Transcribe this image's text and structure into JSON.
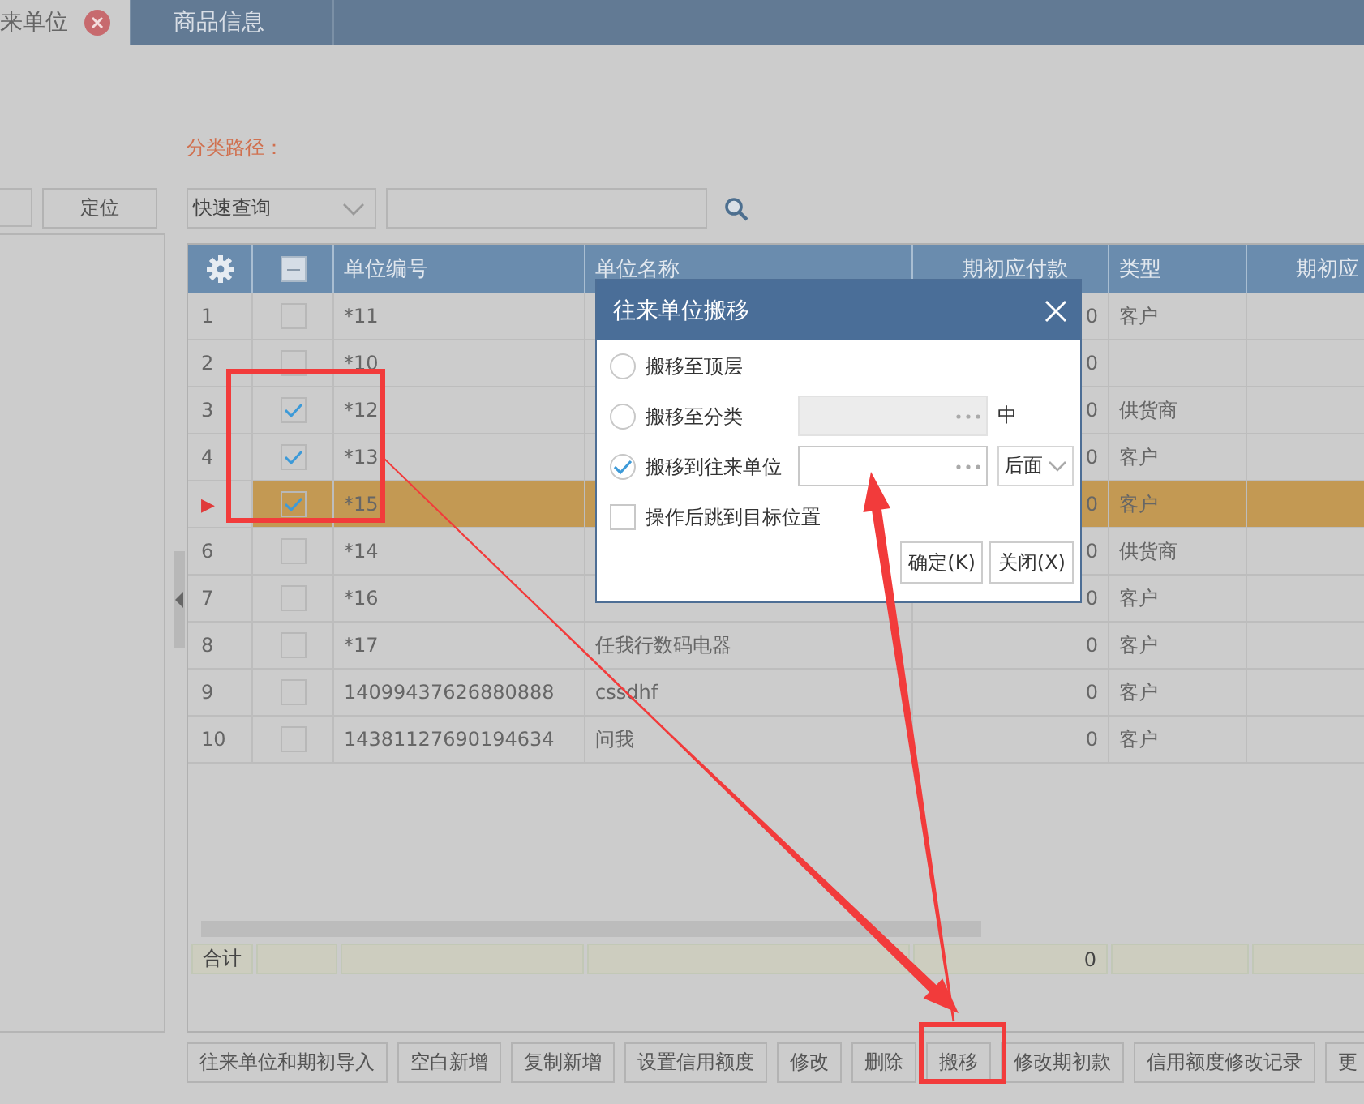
{
  "tabs": [
    {
      "label": "来单位",
      "selected": true,
      "closable": true
    },
    {
      "label": "商品信息",
      "selected": false,
      "closable": false
    }
  ],
  "left_panel": {
    "locate_button": "定位"
  },
  "category_path_label": "分类路径：",
  "toolbar": {
    "query_select": "快速查询"
  },
  "table": {
    "select_all": {
      "indeterminate": true
    },
    "columns": [
      "单位编号",
      "单位名称",
      "期初应付款",
      "类型",
      "期初应"
    ],
    "rows": [
      {
        "index": "1",
        "checked": false,
        "current": false,
        "code": "*11",
        "payable": "0",
        "type": "客户"
      },
      {
        "index": "2",
        "checked": false,
        "current": false,
        "code": "*10",
        "payable": "0"
      },
      {
        "index": "3",
        "checked": true,
        "current": false,
        "code": "*12",
        "payable": "0",
        "type": "供货商"
      },
      {
        "index": "4",
        "checked": true,
        "current": false,
        "code": "*13",
        "payable": "0",
        "type": "客户"
      },
      {
        "checked": true,
        "current": true,
        "marker": "▶",
        "code": "*15",
        "payable": "0",
        "type": "客户"
      },
      {
        "index": "6",
        "checked": false,
        "current": false,
        "code": "*14",
        "payable": "0",
        "type": "供货商"
      },
      {
        "index": "7",
        "checked": false,
        "current": false,
        "code": "*16",
        "payable": "0",
        "type": "客户"
      },
      {
        "index": "8",
        "checked": false,
        "current": false,
        "code": "*17",
        "name": "任我行数码电器",
        "payable": "0",
        "type": "客户"
      },
      {
        "index": "9",
        "checked": false,
        "current": false,
        "code": "14099437626880888",
        "name": "cssdhf",
        "payable": "0",
        "type": "客户"
      },
      {
        "index": "10",
        "checked": false,
        "current": false,
        "code": "14381127690194634",
        "name": "问我",
        "payable": "0",
        "type": "客户"
      }
    ],
    "totals": {
      "label": "合计",
      "payable": "0"
    }
  },
  "buttons": [
    {
      "label": "往来单位和期初导入"
    },
    {
      "label": "空白新增"
    },
    {
      "label": "复制新增"
    },
    {
      "label": "设置信用额度"
    },
    {
      "label": "修改"
    },
    {
      "label": "删除"
    },
    {
      "label": "搬移"
    },
    {
      "label": "修改期初款"
    },
    {
      "label": "信用额度修改记录"
    },
    {
      "label": "更"
    }
  ],
  "dialog": {
    "title": "往来单位搬移",
    "options": [
      {
        "kind": "radio",
        "label": "搬移至顶层",
        "selected": false
      },
      {
        "kind": "radio",
        "label": "搬移至分类",
        "selected": false,
        "field": {
          "disabled": true
        },
        "suffix": "中"
      },
      {
        "kind": "radio",
        "label": "搬移到往来单位",
        "selected": true,
        "field": {
          "disabled": false
        },
        "position": "后面"
      },
      {
        "kind": "checkbox",
        "label": "操作后跳到目标位置",
        "checked": false
      }
    ],
    "buttons": [
      "确定(K)",
      "关闭(X)"
    ]
  }
}
